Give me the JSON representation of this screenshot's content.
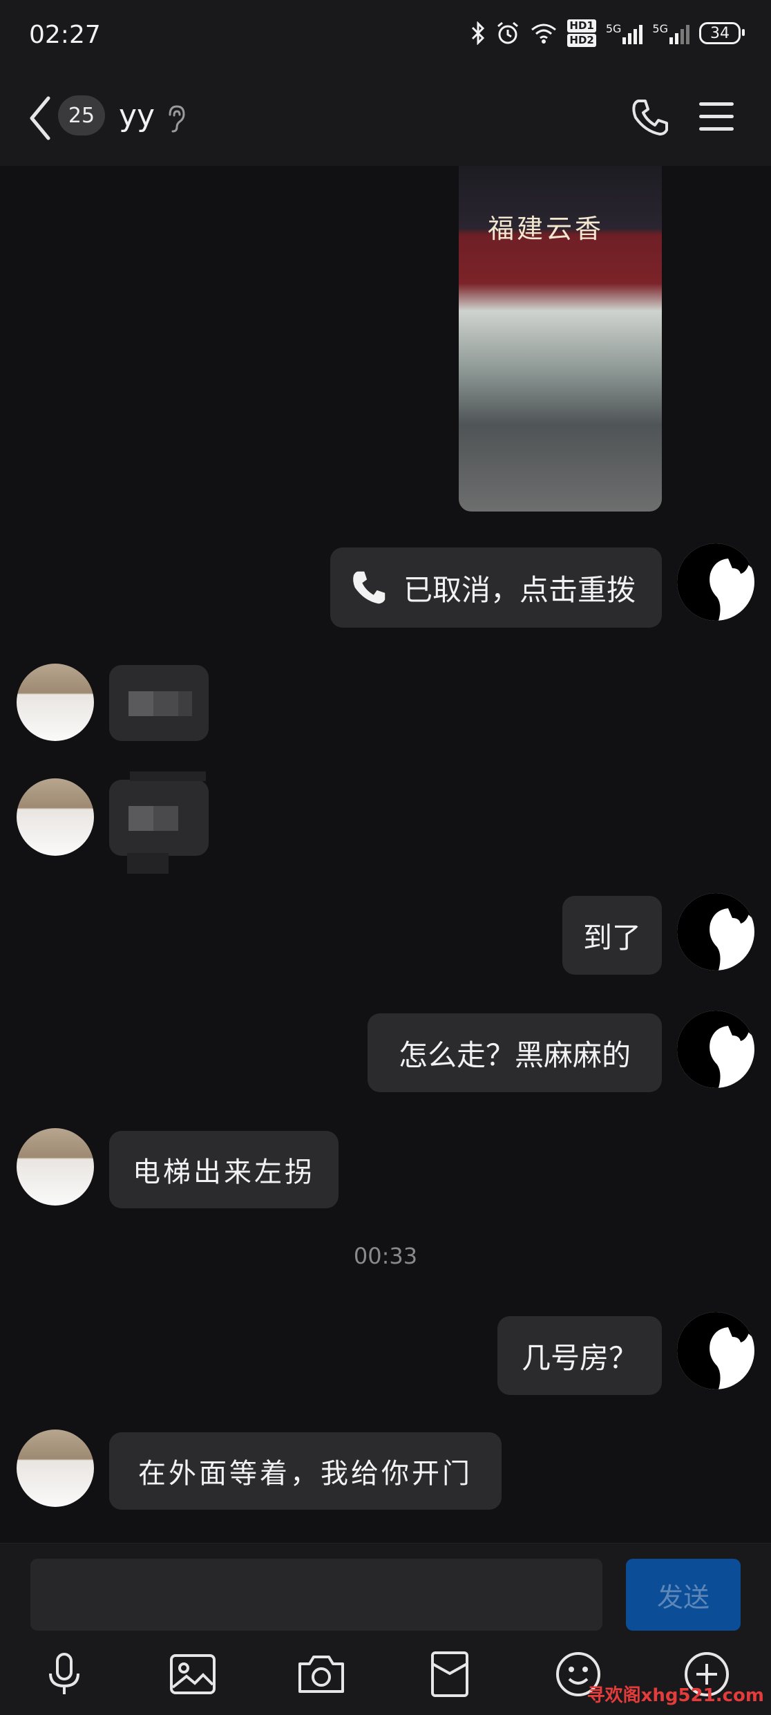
{
  "status_bar": {
    "time": "02:27",
    "network1": "5G",
    "network2": "5G",
    "hd1": "HD1",
    "hd2": "HD2",
    "battery": "34"
  },
  "header": {
    "unread_count": "25",
    "contact_name": "yy"
  },
  "photo": {
    "sign_text": "福建云香"
  },
  "messages": {
    "call_cancelled": "已取消，点击重拨",
    "arrived": "到了",
    "how_to_go": "怎么走？黑麻麻的",
    "elevator": "电梯出来左拐",
    "timestamp": "00:33",
    "room_number": "几号房？",
    "wait_outside": "在外面等着，我给你开门"
  },
  "input": {
    "send_label": "发送"
  },
  "toolbar": {
    "icons": [
      "microphone-icon",
      "image-icon",
      "camera-icon",
      "red-packet-icon",
      "emoji-icon",
      "plus-icon"
    ]
  },
  "watermark": "寻欢阁xhg521.com"
}
